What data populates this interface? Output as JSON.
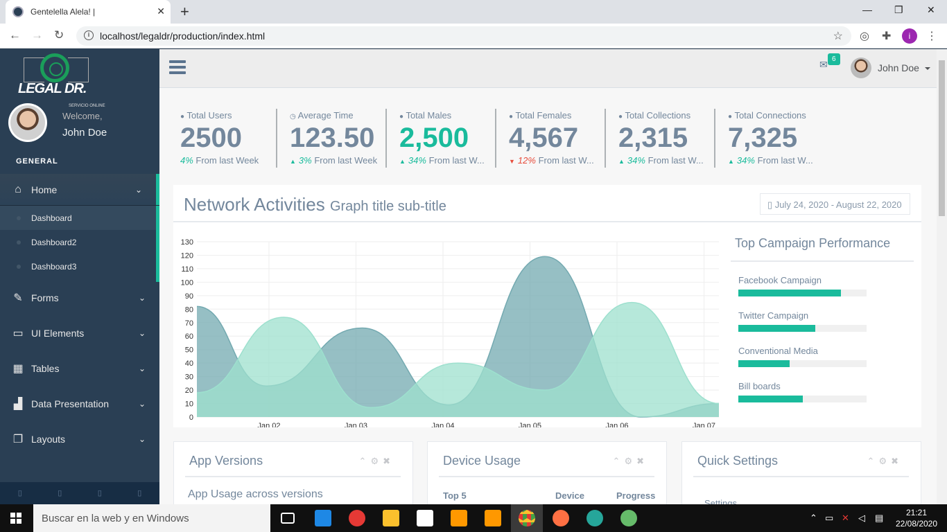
{
  "browser": {
    "tab_title": "Gentelella Alela! |",
    "url": "localhost/legaldr/production/index.html",
    "profile_letter": "i"
  },
  "sidebar": {
    "brand": "LEGAL DR.",
    "brand_sub": "SERVICIO ONLINE",
    "welcome": "Welcome,",
    "user": "John Doe",
    "section": "GENERAL",
    "menu": [
      {
        "label": "Home",
        "icon": "home-icon"
      },
      {
        "label": "Forms",
        "icon": "edit-icon"
      },
      {
        "label": "UI Elements",
        "icon": "desktop-icon"
      },
      {
        "label": "Tables",
        "icon": "table-icon"
      },
      {
        "label": "Data Presentation",
        "icon": "bar-chart-icon"
      },
      {
        "label": "Layouts",
        "icon": "clone-icon"
      }
    ],
    "home_sub": [
      "Dashboard",
      "Dashboard2",
      "Dashboard3"
    ]
  },
  "topnav": {
    "mail_count": "6",
    "user": "John Doe"
  },
  "tiles": [
    {
      "label": "Total Users",
      "value": "2500",
      "pct": "4%",
      "foot": " From last Week",
      "trend": "none",
      "highlight": false
    },
    {
      "label": "Average Time",
      "value": "123.50",
      "pct": "3%",
      "foot": " From last Week",
      "trend": "up",
      "highlight": false
    },
    {
      "label": "Total Males",
      "value": "2,500",
      "pct": "34%",
      "foot": " From last W...",
      "trend": "up",
      "highlight": true
    },
    {
      "label": "Total Females",
      "value": "4,567",
      "pct": "12%",
      "foot": " From last W...",
      "trend": "down",
      "highlight": false
    },
    {
      "label": "Total Collections",
      "value": "2,315",
      "pct": "34%",
      "foot": " From last W...",
      "trend": "up",
      "highlight": false
    },
    {
      "label": "Total Connections",
      "value": "7,325",
      "pct": "34%",
      "foot": " From last W...",
      "trend": "up",
      "highlight": false
    }
  ],
  "network": {
    "title": "Network Activities",
    "subtitle": "Graph title sub-title",
    "date_range": "July 24, 2020 - August 22, 2020"
  },
  "chart_data": {
    "type": "area",
    "x": [
      "Jan 02",
      "Jan 03",
      "Jan 04",
      "Jan 05",
      "Jan 06",
      "Jan 07"
    ],
    "ylim": [
      0,
      130
    ],
    "yticks": [
      0,
      10,
      20,
      30,
      40,
      50,
      60,
      70,
      80,
      90,
      100,
      110,
      120,
      130
    ],
    "series": [
      {
        "color": "#73a9b0",
        "points": [
          [
            0,
            82
          ],
          [
            0.8,
            23
          ],
          [
            1.9,
            66
          ],
          [
            2.9,
            9
          ],
          [
            4.0,
            119
          ],
          [
            5.1,
            0
          ],
          [
            6.0,
            10
          ]
        ]
      },
      {
        "color": "#9de0ce",
        "points": [
          [
            0,
            18
          ],
          [
            1.0,
            74
          ],
          [
            2.0,
            7
          ],
          [
            3.0,
            40
          ],
          [
            4.0,
            20
          ],
          [
            5.0,
            85
          ],
          [
            6.0,
            10
          ]
        ]
      }
    ]
  },
  "campaign": {
    "title": "Top Campaign Performance",
    "items": [
      {
        "label": "Facebook Campaign",
        "value": 0.8
      },
      {
        "label": "Twitter Campaign",
        "value": 0.6
      },
      {
        "label": "Conventional Media",
        "value": 0.4
      },
      {
        "label": "Bill boards",
        "value": 0.5
      }
    ]
  },
  "panels": [
    {
      "title": "App Versions",
      "line1": "App Usage across versions"
    },
    {
      "title": "Device Usage",
      "col1": "Top 5",
      "col2": "Device",
      "col3": "Progress"
    },
    {
      "title": "Quick Settings",
      "line1": "Settings"
    }
  ],
  "taskbar": {
    "search": "Buscar en la web y en Windows",
    "time": "21:21",
    "date": "22/08/2020"
  }
}
